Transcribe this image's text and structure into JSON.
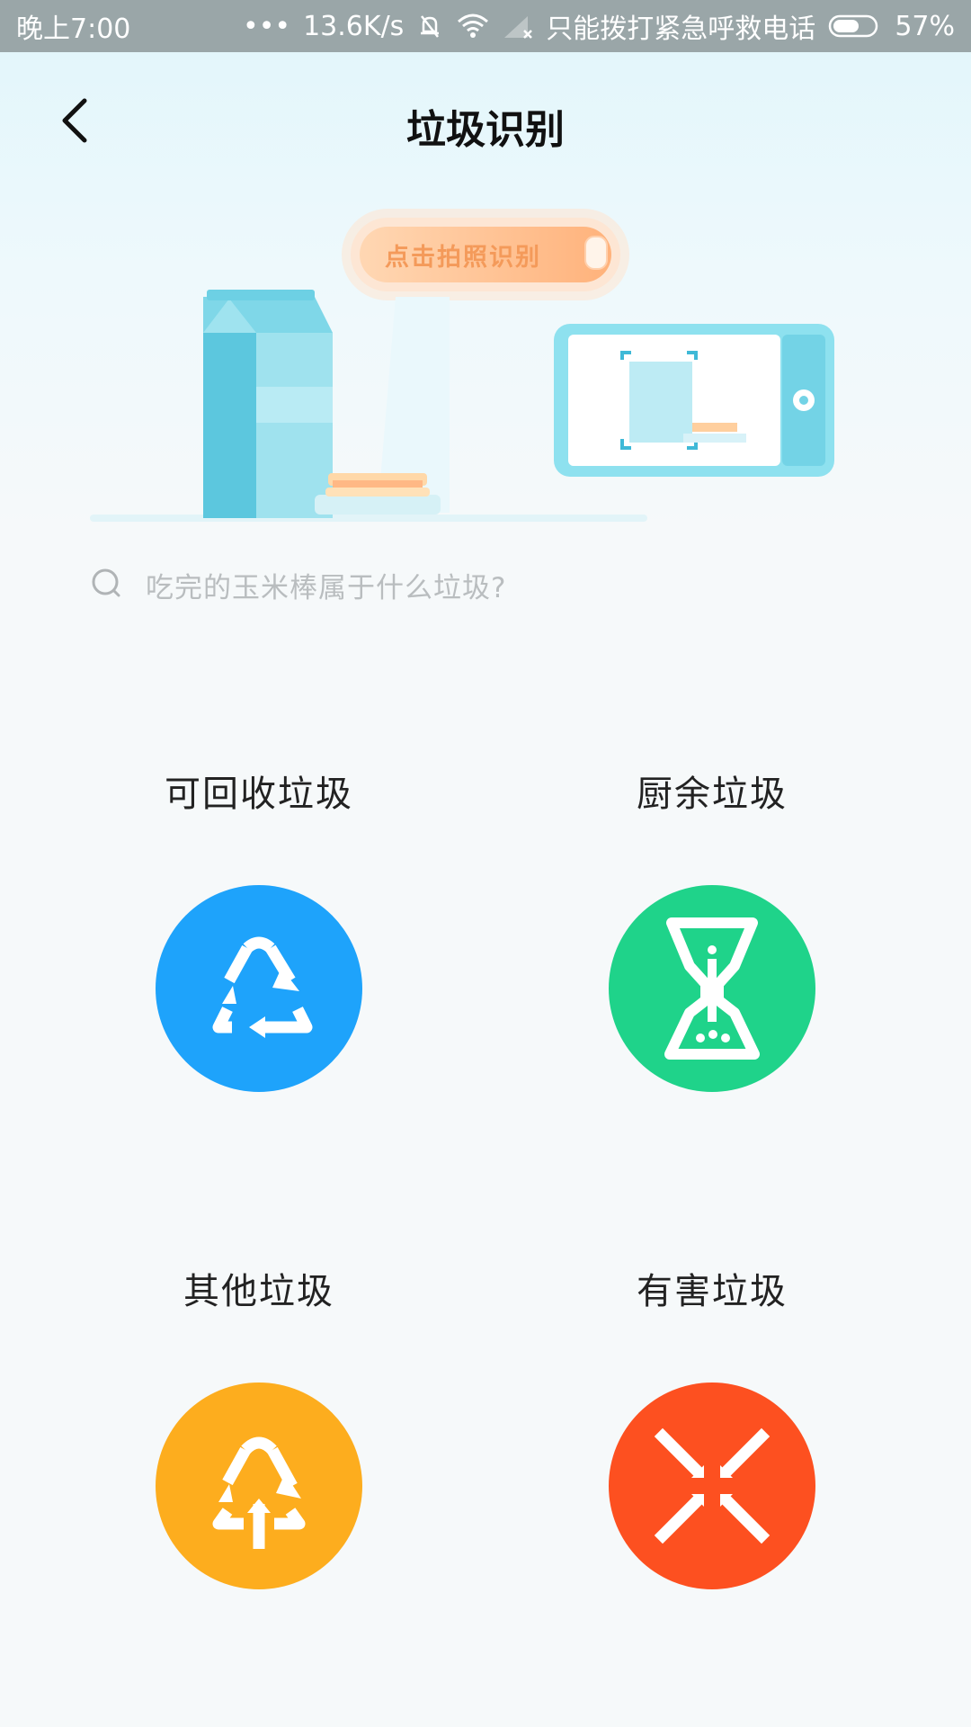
{
  "status_bar": {
    "time": "晚上7:00",
    "dots": "•••",
    "speed": "13.6K/s",
    "carrier": "只能拨打紧急呼救电话",
    "battery": "57%"
  },
  "header": {
    "title": "垃圾识别"
  },
  "hero": {
    "photo_button_label": "点击拍照识别"
  },
  "search": {
    "placeholder": "吃完的玉米棒属于什么垃圾?"
  },
  "categories": [
    {
      "label": "可回收垃圾",
      "icon": "recycle-icon",
      "color": "#1ea3fb"
    },
    {
      "label": "厨余垃圾",
      "icon": "hourglass-icon",
      "color": "#1fd38a"
    },
    {
      "label": "其他垃圾",
      "icon": "recycle-arrows-icon",
      "color": "#fdad1e"
    },
    {
      "label": "有害垃圾",
      "icon": "cross-arrows-icon",
      "color": "#fd5020"
    }
  ],
  "colors": {
    "accent_orange": "#f49a5a",
    "status_bar": "#9aa6a8"
  }
}
